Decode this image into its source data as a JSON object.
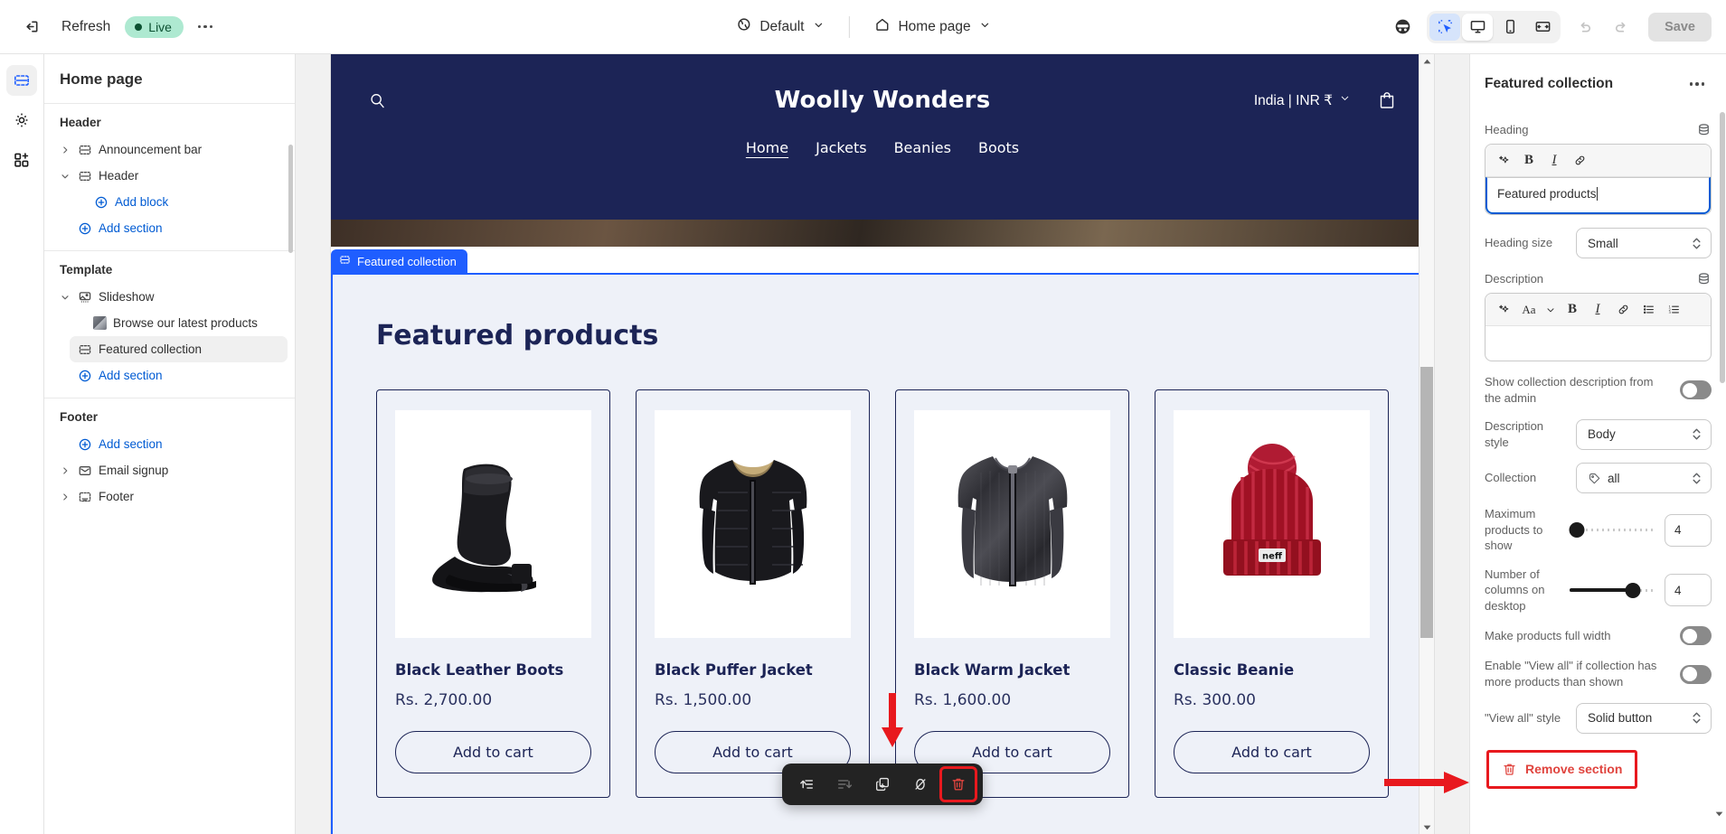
{
  "topbar": {
    "exit_label": "exit-editor",
    "refresh_label": "Refresh",
    "live_label": "Live",
    "more_label": "more-options",
    "theme_selector": "Default",
    "page_selector": "Home page",
    "save_label": "Save",
    "icons": {
      "exit": "exit-icon",
      "globe": "globe-icon",
      "home": "home-icon",
      "incognito": "incognito-icon",
      "select": "select-cursor-icon",
      "desktop": "desktop-icon",
      "mobile": "mobile-icon",
      "fullwidth": "full-width-icon",
      "undo": "undo-icon",
      "redo": "redo-icon"
    }
  },
  "rail": {
    "items": [
      {
        "name": "sections-icon",
        "active": true
      },
      {
        "name": "settings-gear-icon",
        "active": false
      },
      {
        "name": "apps-icon",
        "active": false
      }
    ]
  },
  "sidebar": {
    "title": "Home page",
    "groups": [
      {
        "label": "Header",
        "rows": [
          {
            "label": "Announcement bar",
            "caret": "right",
            "icon": "section-icon",
            "type": "section",
            "indent": 0
          },
          {
            "label": "Header",
            "caret": "down",
            "icon": "section-icon",
            "type": "section",
            "indent": 0
          },
          {
            "label": "Add block",
            "caret": "none",
            "icon": "plus-circle-icon",
            "type": "link",
            "indent": 2
          },
          {
            "label": "Add section",
            "caret": "none",
            "icon": "plus-circle-icon",
            "type": "link",
            "indent": 1
          }
        ]
      },
      {
        "label": "Template",
        "rows": [
          {
            "label": "Slideshow",
            "caret": "down",
            "icon": "image-section-icon",
            "type": "section",
            "indent": 0
          },
          {
            "label": "Browse our latest products",
            "caret": "none",
            "icon": "thumbnail-icon",
            "type": "block",
            "indent": 2
          },
          {
            "label": "Featured collection",
            "caret": "none",
            "icon": "section-icon",
            "type": "section",
            "indent": 1,
            "selected": true
          },
          {
            "label": "Add section",
            "caret": "none",
            "icon": "plus-circle-icon",
            "type": "link",
            "indent": 1
          }
        ]
      },
      {
        "label": "Footer",
        "rows": [
          {
            "label": "Add section",
            "caret": "none",
            "icon": "plus-circle-icon",
            "type": "link",
            "indent": 1
          },
          {
            "label": "Email signup",
            "caret": "right",
            "icon": "envelope-icon",
            "type": "section",
            "indent": 0
          },
          {
            "label": "Footer",
            "caret": "right",
            "icon": "footer-icon",
            "type": "section",
            "indent": 0
          }
        ]
      }
    ]
  },
  "preview": {
    "store": {
      "brand": "Woolly Wonders",
      "locale": "India | INR ₹",
      "nav": [
        {
          "label": "Home",
          "active": true
        },
        {
          "label": "Jackets",
          "active": false
        },
        {
          "label": "Beanies",
          "active": false
        },
        {
          "label": "Boots",
          "active": false
        }
      ]
    },
    "section_badge": "Featured collection",
    "featured_heading": "Featured products",
    "products": [
      {
        "name": "Black Leather Boots",
        "price": "Rs. 2,700.00",
        "cta": "Add to cart",
        "image": "black-leather-boots"
      },
      {
        "name": "Black Puffer Jacket",
        "price": "Rs. 1,500.00",
        "cta": "Add to cart",
        "image": "black-puffer-jacket"
      },
      {
        "name": "Black Warm Jacket",
        "price": "Rs. 1,600.00",
        "cta": "Add to cart",
        "image": "black-warm-jacket"
      },
      {
        "name": "Classic Beanie",
        "price": "Rs. 300.00",
        "cta": "Add to cart",
        "image": "classic-beanie"
      }
    ],
    "float_toolbar": [
      {
        "name": "move-section-up-icon",
        "state": "enabled"
      },
      {
        "name": "move-section-down-icon",
        "state": "disabled"
      },
      {
        "name": "duplicate-section-icon",
        "state": "enabled"
      },
      {
        "name": "hide-section-icon",
        "state": "enabled"
      },
      {
        "name": "delete-section-icon",
        "state": "highlighted"
      }
    ]
  },
  "right_panel": {
    "title": "Featured collection",
    "more_label": "section-options",
    "heading_label": "Heading",
    "heading_value": "Featured products",
    "heading_toolbar": [
      "ai-sparkle-icon",
      "bold-icon",
      "italic-icon",
      "link-icon"
    ],
    "heading_size_label": "Heading size",
    "heading_size_value": "Small",
    "description_label": "Description",
    "description_value": "",
    "description_toolbar": [
      "ai-sparkle-icon",
      "font-size-icon",
      "bold-icon",
      "italic-icon",
      "link-icon",
      "bullet-list-icon",
      "numbered-list-icon"
    ],
    "show_collection_desc_label": "Show collection description from the admin",
    "show_collection_desc_value": "off",
    "description_style_label": "Description style",
    "description_style_value": "Body",
    "collection_label": "Collection",
    "collection_value": "all",
    "max_products_label": "Maximum products to show",
    "max_products_value": "4",
    "max_products_pct": 8,
    "columns_label": "Number of columns on desktop",
    "columns_value": "4",
    "columns_pct": 74,
    "full_width_label": "Make products full width",
    "full_width_value": "off",
    "view_all_enable_label": "Enable \"View all\" if collection has more products than shown",
    "view_all_enable_value": "off",
    "view_all_style_label": "\"View all\" style",
    "view_all_style_value": "Solid button",
    "remove_section_label": "Remove section"
  },
  "colors": {
    "accent_blue": "#1f5eff",
    "link_blue": "#005bd3",
    "store_navy": "#1c2456",
    "section_bg": "#eef1f8",
    "danger_red": "#e0443e",
    "annotation_red": "#e8191e",
    "live_green": "#aee9d1"
  }
}
